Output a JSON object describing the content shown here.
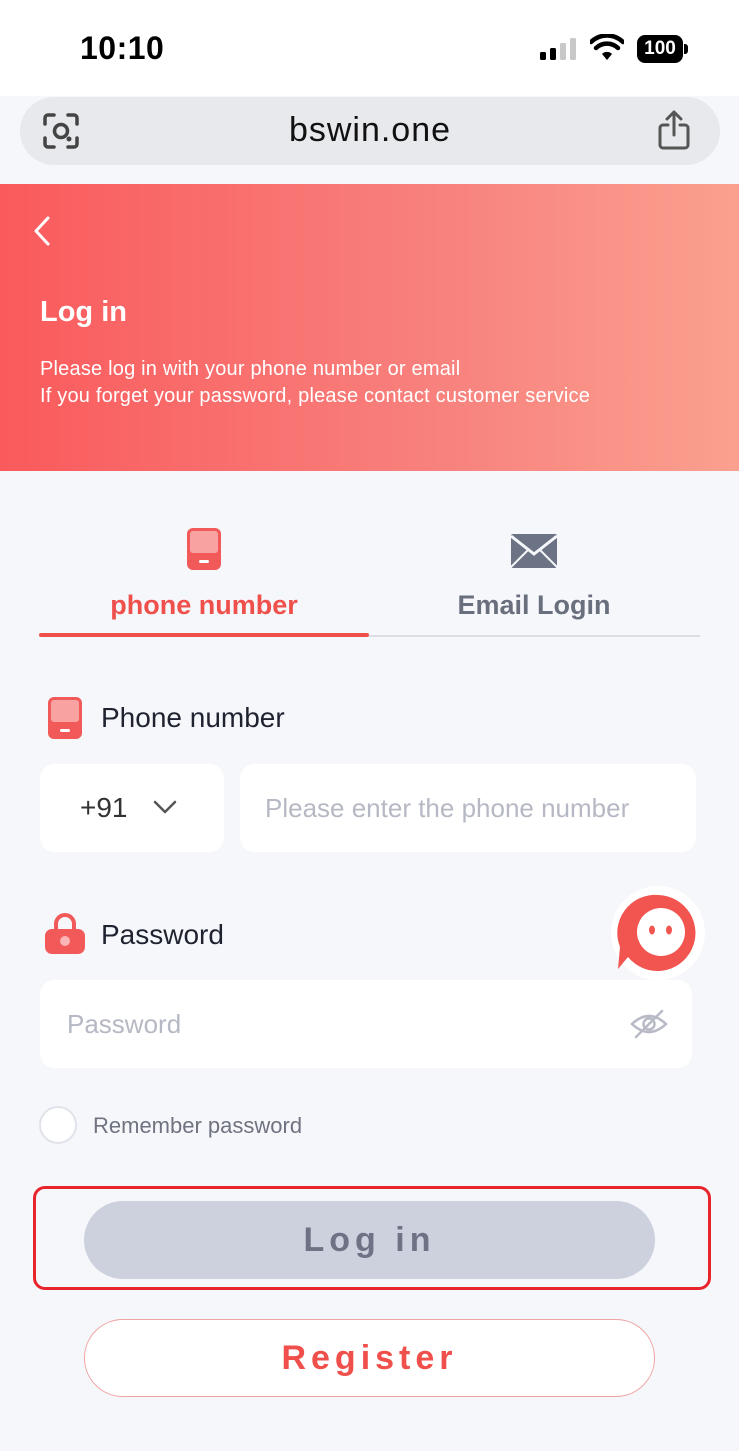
{
  "status_bar": {
    "time": "10:10",
    "battery": "100"
  },
  "browser": {
    "url": "bswin.one"
  },
  "header": {
    "title": "Log in",
    "subtitle_line1": "Please log in with your phone number or email",
    "subtitle_line2": "If you forget your password, please contact customer service"
  },
  "tabs": [
    {
      "label": "phone number",
      "icon": "phone-icon",
      "active": true
    },
    {
      "label": "Email Login",
      "icon": "mail-icon",
      "active": false
    }
  ],
  "form": {
    "phone_label": "Phone number",
    "country_code": "+91",
    "phone_placeholder": "Please enter the phone number",
    "password_label": "Password",
    "password_placeholder": "Password",
    "remember_label": "Remember password"
  },
  "buttons": {
    "login": "Log in",
    "register": "Register"
  },
  "colors": {
    "accent": "#f0504c",
    "header_start": "#fa5a5c",
    "header_end": "#fba08f",
    "disabled_button": "#cdd0dd"
  }
}
